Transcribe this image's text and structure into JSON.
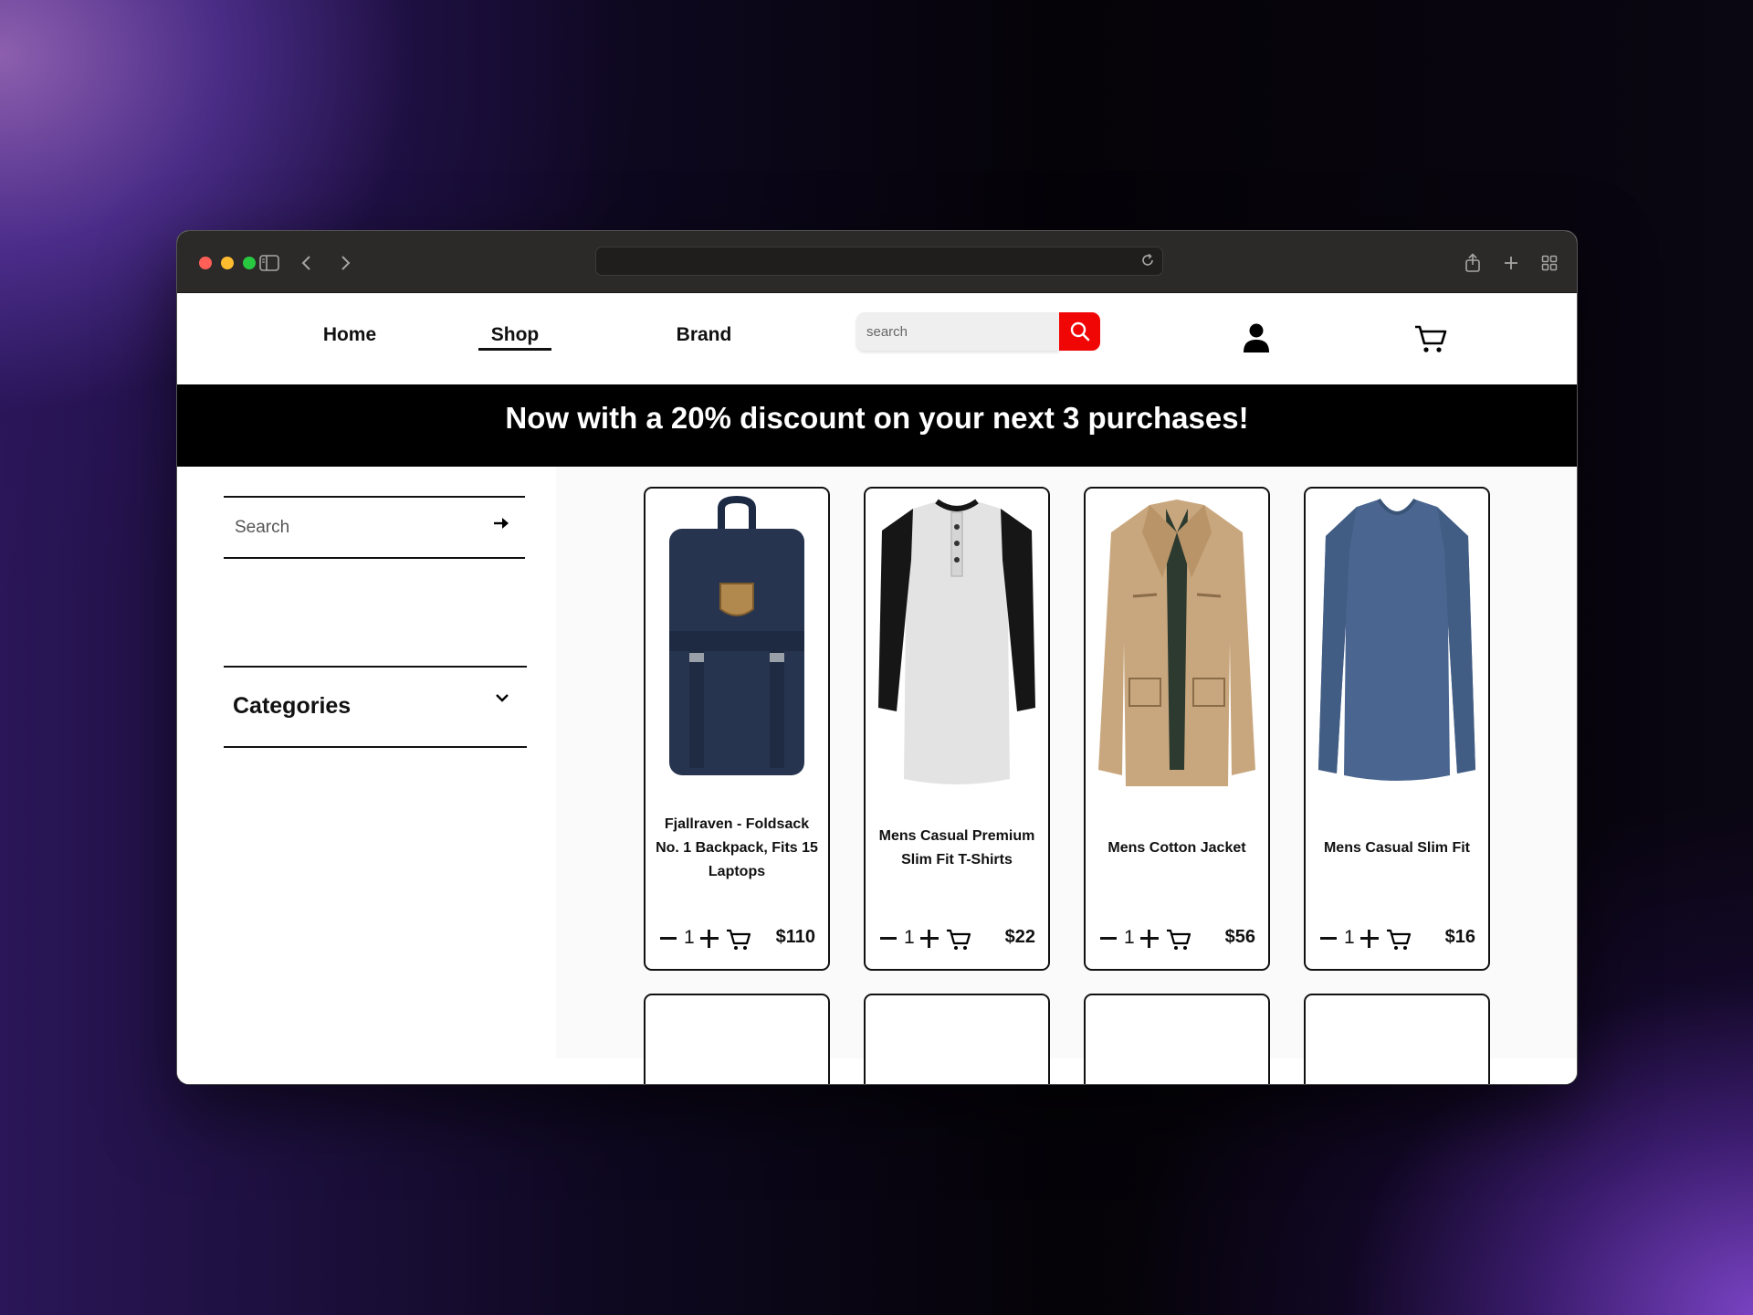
{
  "nav": {
    "home": "Home",
    "shop": "Shop",
    "brand": "Brand",
    "search_placeholder": "search"
  },
  "banner": "Now with a 20% discount on your next 3 purchases!",
  "sidebar": {
    "search_placeholder": "Search",
    "categories_label": "Categories"
  },
  "products": [
    {
      "title": "Fjallraven - Foldsack No. 1 Backpack, Fits 15 Laptops",
      "qty": "1",
      "price": "$110"
    },
    {
      "title": "Mens Casual Premium Slim Fit T-Shirts",
      "qty": "1",
      "price": "$22"
    },
    {
      "title": "Mens Cotton Jacket",
      "qty": "1",
      "price": "$56"
    },
    {
      "title": "Mens Casual Slim Fit",
      "qty": "1",
      "price": "$16"
    }
  ],
  "colors": {
    "accent_red": "#f10606",
    "banner_bg": "#000000",
    "titlebar": "#2b2a29"
  }
}
